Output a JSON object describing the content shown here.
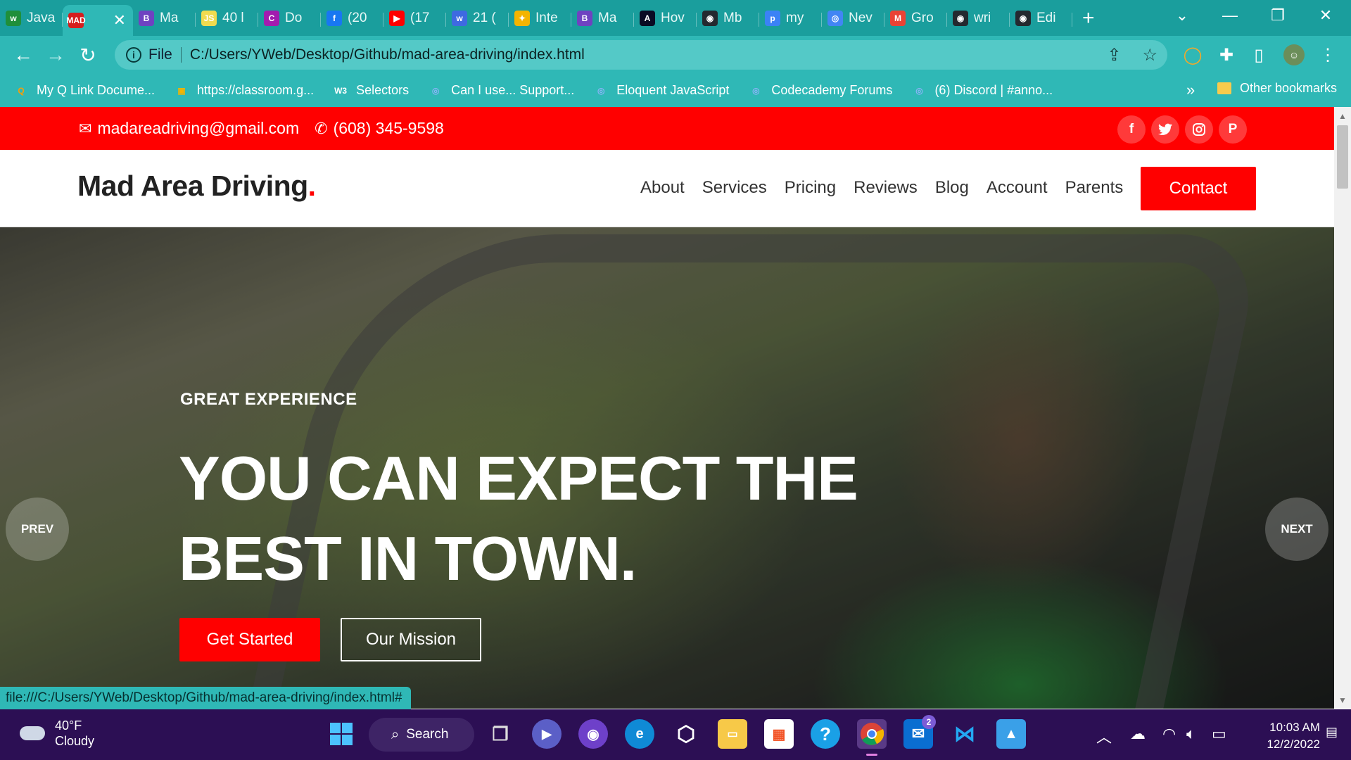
{
  "browser": {
    "tabs": [
      {
        "label": "Java",
        "fav": "w",
        "fav_color": "#1f8f3a"
      },
      {
        "label": "",
        "fav": "MAD",
        "fav_color": "#d61d1d",
        "active": true
      },
      {
        "label": "Ma",
        "fav": "B",
        "fav_color": "#6f42c1"
      },
      {
        "label": "40 l",
        "fav": "JS",
        "fav_color": "#f0db4f"
      },
      {
        "label": "Do",
        "fav": "C",
        "fav_color": "#a21caf"
      },
      {
        "label": "(20",
        "fav": "f",
        "fav_color": "#1877f2"
      },
      {
        "label": "(17",
        "fav": "▶",
        "fav_color": "#ff0000"
      },
      {
        "label": "21 (",
        "fav": "w",
        "fav_color": "#3e6ae1"
      },
      {
        "label": "Inte",
        "fav": "✦",
        "fav_color": "#f4b400"
      },
      {
        "label": "Ma",
        "fav": "B",
        "fav_color": "#6f42c1"
      },
      {
        "label": "Hov",
        "fav": "A",
        "fav_color": "#0a0a23"
      },
      {
        "label": "Mb",
        "fav": "◉",
        "fav_color": "#24292f"
      },
      {
        "label": "my",
        "fav": "p",
        "fav_color": "#3b82f6"
      },
      {
        "label": "Nev",
        "fav": "◎",
        "fav_color": "#4285f4"
      },
      {
        "label": "Gro",
        "fav": "M",
        "fav_color": "#ea4335"
      },
      {
        "label": "wri",
        "fav": "◉",
        "fav_color": "#24292f"
      },
      {
        "label": "Edi",
        "fav": "◉",
        "fav_color": "#24292f"
      }
    ],
    "address": {
      "scheme_label": "File",
      "url": "C:/Users/YWeb/Desktop/Github/mad-area-driving/index.html"
    },
    "bookmarks": [
      {
        "label": "My Q Link Docume...",
        "icon": "Q",
        "color": "#f59e0b"
      },
      {
        "label": "https://classroom.g...",
        "icon": "▣",
        "color": "#f4b400"
      },
      {
        "label": "Selectors",
        "icon": "W3",
        "color": "#ffffff"
      },
      {
        "label": "Can I use... Support...",
        "icon": "◎",
        "color": "#8ab4f8"
      },
      {
        "label": "Eloquent JavaScript",
        "icon": "◎",
        "color": "#8ab4f8"
      },
      {
        "label": "Codecademy Forums",
        "icon": "◎",
        "color": "#8ab4f8"
      },
      {
        "label": "(6) Discord | #anno...",
        "icon": "◎",
        "color": "#8ab4f8"
      }
    ],
    "bookmarks_more": "»",
    "other_bookmarks": "Other bookmarks",
    "status_url": "file:///C:/Users/YWeb/Desktop/Github/mad-area-driving/index.html#"
  },
  "site": {
    "topbar": {
      "email": "madareadriving@gmail.com",
      "phone": "(608) 345-9598",
      "social": [
        "f",
        "t",
        "ig",
        "p"
      ]
    },
    "logo": {
      "name": "Mad Area Driving",
      "dot": "."
    },
    "nav": [
      "About",
      "Services",
      "Pricing",
      "Reviews",
      "Blog",
      "Account",
      "Parents"
    ],
    "contact_label": "Contact",
    "hero": {
      "kicker": "GREAT EXPERIENCE",
      "headline_line1": "YOU CAN EXPECT THE",
      "headline_line2": "BEST IN TOWN.",
      "cta_primary": "Get Started",
      "cta_secondary": "Our Mission",
      "prev_label": "PREV",
      "next_label": "NEXT"
    },
    "accent_color": "#ff0000"
  },
  "taskbar": {
    "weather_temp": "40°F",
    "weather_desc": "Cloudy",
    "search_label": "Search",
    "mail_badge": "2",
    "time": "10:03 AM",
    "date": "12/2/2022"
  }
}
